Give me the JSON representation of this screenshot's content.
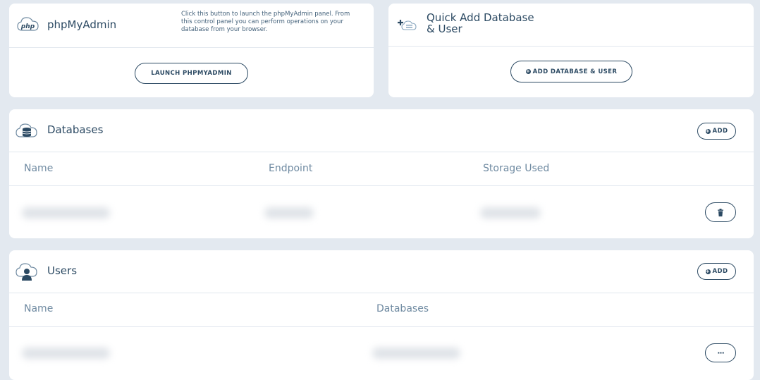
{
  "phpmyadmin": {
    "title": "phpMyAdmin",
    "logo_text": "php",
    "description": "Click this button to launch the phpMyAdmin panel. From this control panel you can perform operations on your database from your browser.",
    "launch_label": "LAUNCH PHPMYADMIN"
  },
  "quick_add": {
    "title_line1": "Quick Add Database",
    "title_line2": "& User",
    "button_label": "ADD DATABASE & USER"
  },
  "databases": {
    "title": "Databases",
    "add_label": "ADD",
    "columns": [
      "Name",
      "Endpoint",
      "Storage Used"
    ]
  },
  "users": {
    "title": "Users",
    "add_label": "ADD",
    "columns": [
      "Name",
      "Databases"
    ],
    "more_label": "···"
  },
  "colors": {
    "accent": "#2c4a63",
    "background": "#e3e9f0",
    "muted": "#6f8aa1"
  }
}
